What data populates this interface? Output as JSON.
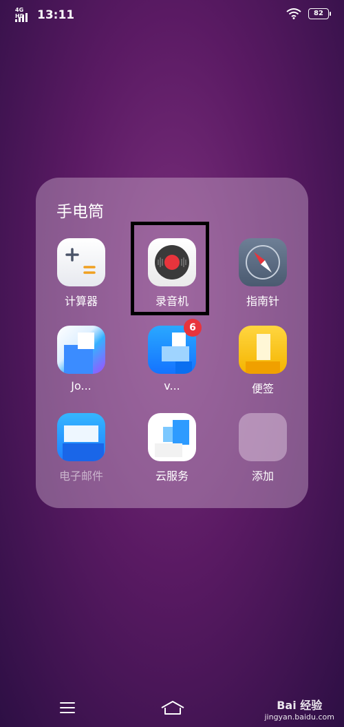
{
  "status_bar": {
    "network": "4G HD",
    "time": "13:11",
    "battery": "82"
  },
  "folder": {
    "title": "手电筒",
    "apps": [
      {
        "label": "计算器",
        "icon": "calculator-icon"
      },
      {
        "label": "录音机",
        "icon": "recorder-icon"
      },
      {
        "label": "指南针",
        "icon": "compass-icon"
      },
      {
        "label": "Jo...",
        "icon": "jovi-icon"
      },
      {
        "label": "v...",
        "icon": "vivo-icon",
        "badge": "6"
      },
      {
        "label": "便签",
        "icon": "notes-icon"
      },
      {
        "label": "电子邮件",
        "icon": "email-icon"
      },
      {
        "label": "云服务",
        "icon": "cloud-service-icon"
      },
      {
        "label": "添加",
        "icon": "add-icon"
      }
    ]
  },
  "navigation": {
    "menu_icon": "menu-icon",
    "home_icon": "home-icon"
  },
  "watermark": {
    "main": "Bai 经验",
    "sub": "jingyan.baidu.com"
  },
  "colors": {
    "highlight": "#000000",
    "badge": "#e8343c",
    "record_dot": "#e8343c"
  }
}
